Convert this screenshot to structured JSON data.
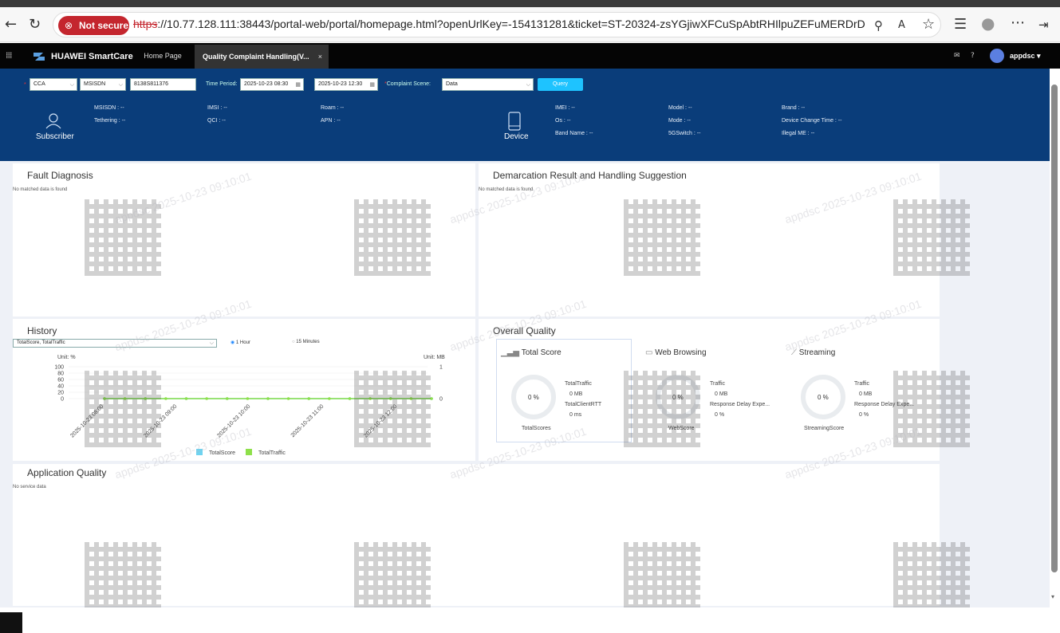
{
  "browser": {
    "security_label": "Not secure",
    "url_scheme": "https",
    "url_rest": "://10.77.128.111:38443/portal-web/portal/homepage.html?openUrlKey=-154131281&ticket=ST-20324-zsYGjiwXFCuSpAbtRHIlpuZEFuMERDrD"
  },
  "app": {
    "brand": "HUAWEI SmartCare",
    "tabs": [
      {
        "label": "Home Page"
      },
      {
        "label": "Quality Complaint Handling(V..."
      }
    ],
    "tab_close": "×",
    "user": "appdsc"
  },
  "query": {
    "type_select": "CCA",
    "id_type_select": "MSISDN",
    "msisdn_value": "8138S811376",
    "time_period_label": "Time Period:",
    "start_time": "2025-10-23 08:30",
    "end_time": "2025-10-23 12:30",
    "scene_label": "Complaint Scene:",
    "scene_value": "Data",
    "query_button": "Query"
  },
  "subscriber": {
    "title": "Subscriber",
    "msisdn": "MSISDN : --",
    "tethering": "Tethering : --",
    "imsi": "IMSI : --",
    "qci": "QCI : --",
    "roam": "Roam : --",
    "apn": "APN : --"
  },
  "device": {
    "title": "Device",
    "imei": "IMEI : --",
    "os": "Os : --",
    "band": "Band Name : --",
    "model": "Model : --",
    "mode": "Mode : --",
    "fiveg": "5GSwitch : --",
    "brand": "Brand : --",
    "change_time": "Device Change Time : --",
    "illegal": "Illegal ME : --"
  },
  "panels": {
    "fault_title": "Fault Diagnosis",
    "fault_nodata": "No matched data is found",
    "demarc_title": "Demarcation Result and Handling Suggestion",
    "demarc_nodata": "No matched data is found",
    "history_title": "History",
    "history_select": "TotalScore, TotalTraffic",
    "radio_1h": "1 Hour",
    "radio_15m": "15 Minutes",
    "overall_title": "Overall Quality",
    "app_title": "Application Quality",
    "app_nodata": "No service data"
  },
  "overall": {
    "total": {
      "title": "Total Score",
      "value": "0 %",
      "caption": "TotalScores",
      "m1": "TotalTraffic",
      "v1": "0 MB",
      "m2": "TotalClientRTT",
      "v2": "0 ms"
    },
    "web": {
      "title": "Web Browsing",
      "value": "0 %",
      "caption": "WebScore",
      "m1": "Traffic",
      "v1": "0 MB",
      "m2": "Response Delay Expe...",
      "v2": "0 %"
    },
    "stream": {
      "title": "Streaming",
      "value": "0 %",
      "caption": "StreamingScore",
      "m1": "Traffic",
      "v1": "0 MB",
      "m2": "Response Delay Expe...",
      "v2": "0 %"
    }
  },
  "watermark": "appdsc 2025-10-23 09:10:01",
  "chart_data": {
    "type": "line",
    "categories": [
      "2025-10-23 08:00",
      "2025-10-23 09:00",
      "2025-10-23 10:00",
      "2025-10-23 11:00",
      "2025-10-23 12:00"
    ],
    "yleft_label": "Unit: %",
    "yright_label": "Unit: MB",
    "yleft_ticks": [
      "100",
      "80",
      "60",
      "40",
      "20",
      "0"
    ],
    "yright_ticks": [
      "1",
      "0"
    ],
    "ylim_left": [
      0,
      100
    ],
    "ylim_right": [
      0,
      1
    ],
    "series": [
      {
        "name": "TotalScore",
        "color": "#6fd3f0",
        "values": [
          0,
          0,
          0,
          0,
          0,
          0,
          0,
          0,
          0,
          0,
          0,
          0,
          0,
          0,
          0,
          0,
          0
        ]
      },
      {
        "name": "TotalTraffic",
        "color": "#8ee04a",
        "values": [
          0,
          0,
          0,
          0,
          0,
          0,
          0,
          0,
          0,
          0,
          0,
          0,
          0,
          0,
          0,
          0,
          0
        ]
      }
    ],
    "legend": "bottom"
  }
}
